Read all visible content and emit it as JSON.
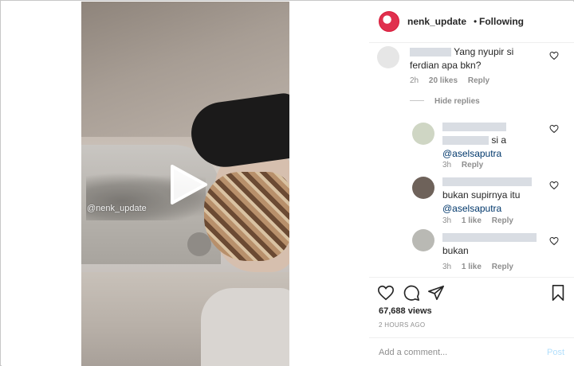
{
  "post": {
    "username": "nenk_update",
    "separator": "•",
    "follow_status": "Following",
    "video_watermark": "@nenk_update",
    "views": "67,688 views",
    "time_ago": "2 HOURS AGO"
  },
  "comments": {
    "main": {
      "text": "Yang nyupir si ferdian apa bkn?",
      "time": "2h",
      "likes": "20 likes",
      "reply": "Reply"
    },
    "hide_replies": "Hide replies",
    "replies": [
      {
        "text": "si a",
        "mention": "@aselsaputra",
        "time": "3h",
        "reply": "Reply"
      },
      {
        "text": "bukan supirnya itu",
        "mention": "@aselsaputra",
        "time": "3h",
        "likes": "1 like",
        "reply": "Reply"
      },
      {
        "text": "bukan",
        "time": "3h",
        "likes": "1 like",
        "reply": "Reply"
      }
    ]
  },
  "add_comment": {
    "placeholder": "Add a comment...",
    "post_label": "Post"
  },
  "colors": {
    "accent_blue_disabled": "#b2dffc",
    "mention": "#00376b",
    "meta_gray": "#8e8e8e"
  }
}
